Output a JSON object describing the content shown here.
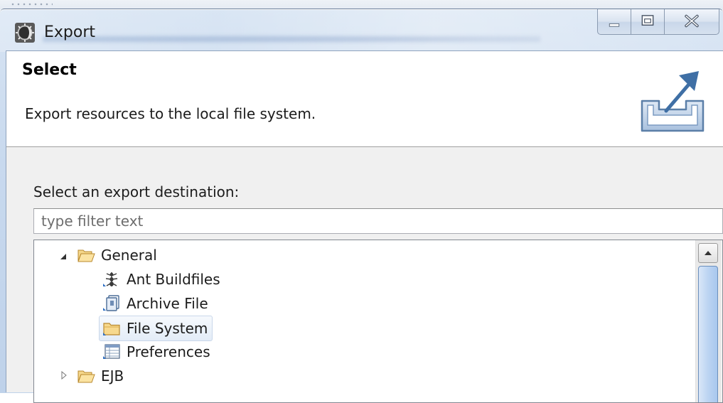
{
  "window": {
    "title": "Export"
  },
  "banner": {
    "title": "Select",
    "description": "Export resources to the local file system."
  },
  "main": {
    "destination_label": "Select an export destination:",
    "filter_placeholder": "type filter text"
  },
  "tree": {
    "items": [
      {
        "label": "General",
        "icon": "folder-open-icon",
        "expanded": true
      },
      {
        "label": "Ant Buildfiles",
        "icon": "ant-icon"
      },
      {
        "label": "Archive File",
        "icon": "archive-file-icon"
      },
      {
        "label": "File System",
        "icon": "folder-icon",
        "selected": true
      },
      {
        "label": "Preferences",
        "icon": "preferences-icon"
      },
      {
        "label": "EJB",
        "icon": "folder-icon",
        "expanded": false
      }
    ]
  },
  "colors": {
    "folder": "#f2c76c",
    "selection": "#e3ecf7",
    "scroll_thumb": "#bcd4f2"
  }
}
